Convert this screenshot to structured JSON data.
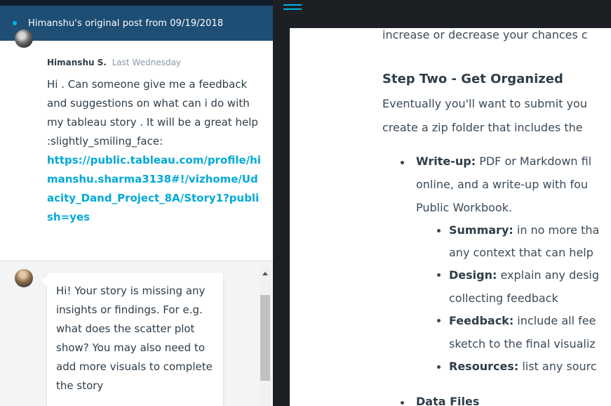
{
  "chat": {
    "banner": "Himanshu's original post from 09/19/2018",
    "post": {
      "author": "Himanshu S.",
      "time": "Last Wednesday",
      "text": "Hi . Can someone give me a feedback and suggestions on what can i do with my tableau story . It will be a great help :slightly_smiling_face:",
      "link": "https://public.tableau.com/profile/himanshu.sharma3138#!/vizhome/Udacity_Dand_Project_8A/Story1?publish=yes"
    },
    "reply": {
      "text": "Hi! Your story is missing any insights or findings. For e.g. what does the scatter plot show? You may also need to add more visuals to complete the story"
    }
  },
  "content": {
    "line0": "increase or decrease your chances c",
    "step_heading": "Step Two - Get Organized",
    "para1": "Eventually you'll want to submit you",
    "para2": "create a zip folder that includes the",
    "writeup_label": "Write-up:",
    "writeup_l1": " PDF or Markdown fil",
    "writeup_l2": "online, and a write-up with fou",
    "writeup_l3": "Public Workbook.",
    "summary_label": "Summary:",
    "summary_l1": " in no more tha",
    "summary_l2": "any context that can help",
    "design_label": "Design:",
    "design_l1": " explain any desig",
    "design_l2": "collecting feedback",
    "feedback_label": "Feedback:",
    "feedback_l1": " include all fee",
    "feedback_l2": "sketch to the final visualiz",
    "resources_label": "Resources:",
    "resources_l1": " list any sourc",
    "datafiles_label": "Data Files"
  }
}
